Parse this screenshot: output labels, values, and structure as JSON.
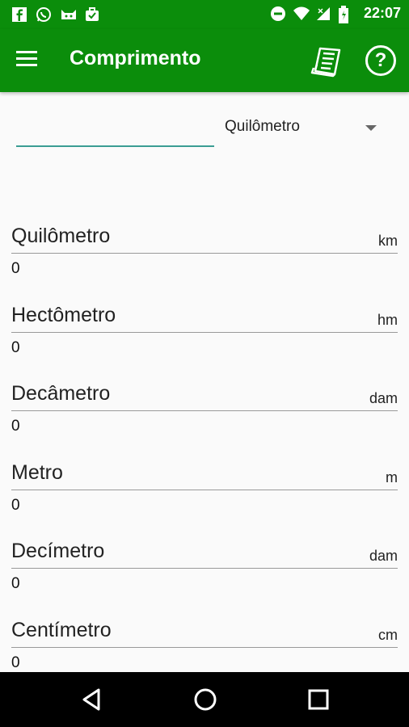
{
  "status_bar": {
    "time": "22:07",
    "left_icons": [
      "facebook-icon",
      "whatsapp-icon",
      "cat-icon",
      "briefcase-check-icon"
    ],
    "right_icons": [
      "do-not-disturb-icon",
      "wifi-icon",
      "signal-icon",
      "battery-icon"
    ]
  },
  "app_bar": {
    "title": "Comprimento",
    "menu_icon": "menu-icon",
    "book_icon": "notebook-icon",
    "help_icon": "help-icon",
    "help_glyph": "?"
  },
  "input": {
    "value": "",
    "selected_unit": "Quilômetro"
  },
  "units": [
    {
      "name": "Quilômetro",
      "abbr": "km",
      "value": "0"
    },
    {
      "name": "Hectômetro",
      "abbr": "hm",
      "value": "0"
    },
    {
      "name": "Decâmetro",
      "abbr": "dam",
      "value": "0"
    },
    {
      "name": "Metro",
      "abbr": "m",
      "value": "0"
    },
    {
      "name": "Decímetro",
      "abbr": "dam",
      "value": "0"
    },
    {
      "name": "Centímetro",
      "abbr": "cm",
      "value": "0"
    }
  ],
  "colors": {
    "primary": "#0b8d0b",
    "accent": "#3b9d93"
  },
  "nav_bar": {
    "buttons": [
      "back-icon",
      "home-icon",
      "recents-icon"
    ]
  }
}
